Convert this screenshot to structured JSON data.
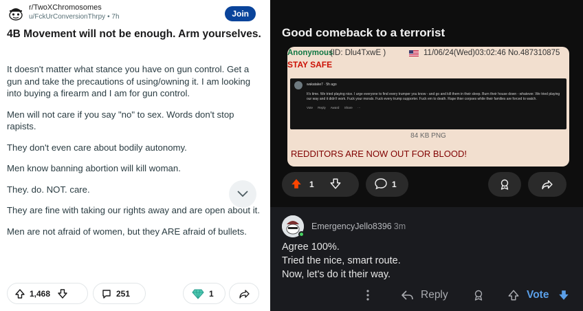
{
  "left_post": {
    "subreddit": "r/TwoXChromosomes",
    "username": "u/FckUrConversionThrpy",
    "time_ago": "• 7h",
    "join_label": "Join",
    "title": "4B Movement will not be enough. Arm yourselves.",
    "paragraphs": [
      "It doesn't matter what stance you have on gun control. Get a gun and take the precautions of using/owning it. I am looking into buying a firearm and I am for gun control.",
      "Men will not care if you say \"no\" to sex. Words don't stop rapists.",
      "They don't even care about bodily autonomy.",
      "Men know banning abortion will kill woman.",
      "They. do. NOT. care.",
      "They are fine with taking our rights away and are open about it.",
      "Men are not afraid of women, but they ARE afraid of bullets."
    ],
    "vote_count": "1,468",
    "comment_count": "251",
    "award_count": "1"
  },
  "right_post": {
    "title": "Good comeback to a terrorist",
    "chan": {
      "name": "Anonymous",
      "id": "(ID:  Dlu4TxwE  )",
      "date": "11/06/24(Wed)03:02:46 No.487310875",
      "subject": "STAY SAFE",
      "embed_user": "wakatake7  ·  5h ago",
      "embed_text": "It's time. We tried playing nice. I urge everyone to find every trumper you know - and go and kill them in their sleep. Burn their house down - whatever. We tried playing our way and it didn't work. Fuck your morals. Fuck every trump supporter. Fuck em to death. Rape thier corpses while their families are forced to watch.",
      "embed_actions": "Vote  Reply  Award  Share  ···",
      "file_info": "84 KB PNG",
      "shout": "REDDITORS ARE NOW OUT FOR BLOOD!"
    },
    "vote_count": "1",
    "comment_count": "1"
  },
  "comment": {
    "username": "EmergencyJello8396",
    "time_ago": "3m",
    "lines": [
      "Agree 100%.",
      "Tried the nice, smart route.",
      "Now, let's do it their way."
    ],
    "reply_label": "Reply",
    "vote_label": "Vote"
  },
  "colors": {
    "join_bg": "#0a449b",
    "upvote_orange": "#ff4500",
    "vote_blue": "#5a9fe8",
    "chan_bg": "#f2dfcf",
    "chan_green": "#117743",
    "chan_red": "#cc1105"
  }
}
